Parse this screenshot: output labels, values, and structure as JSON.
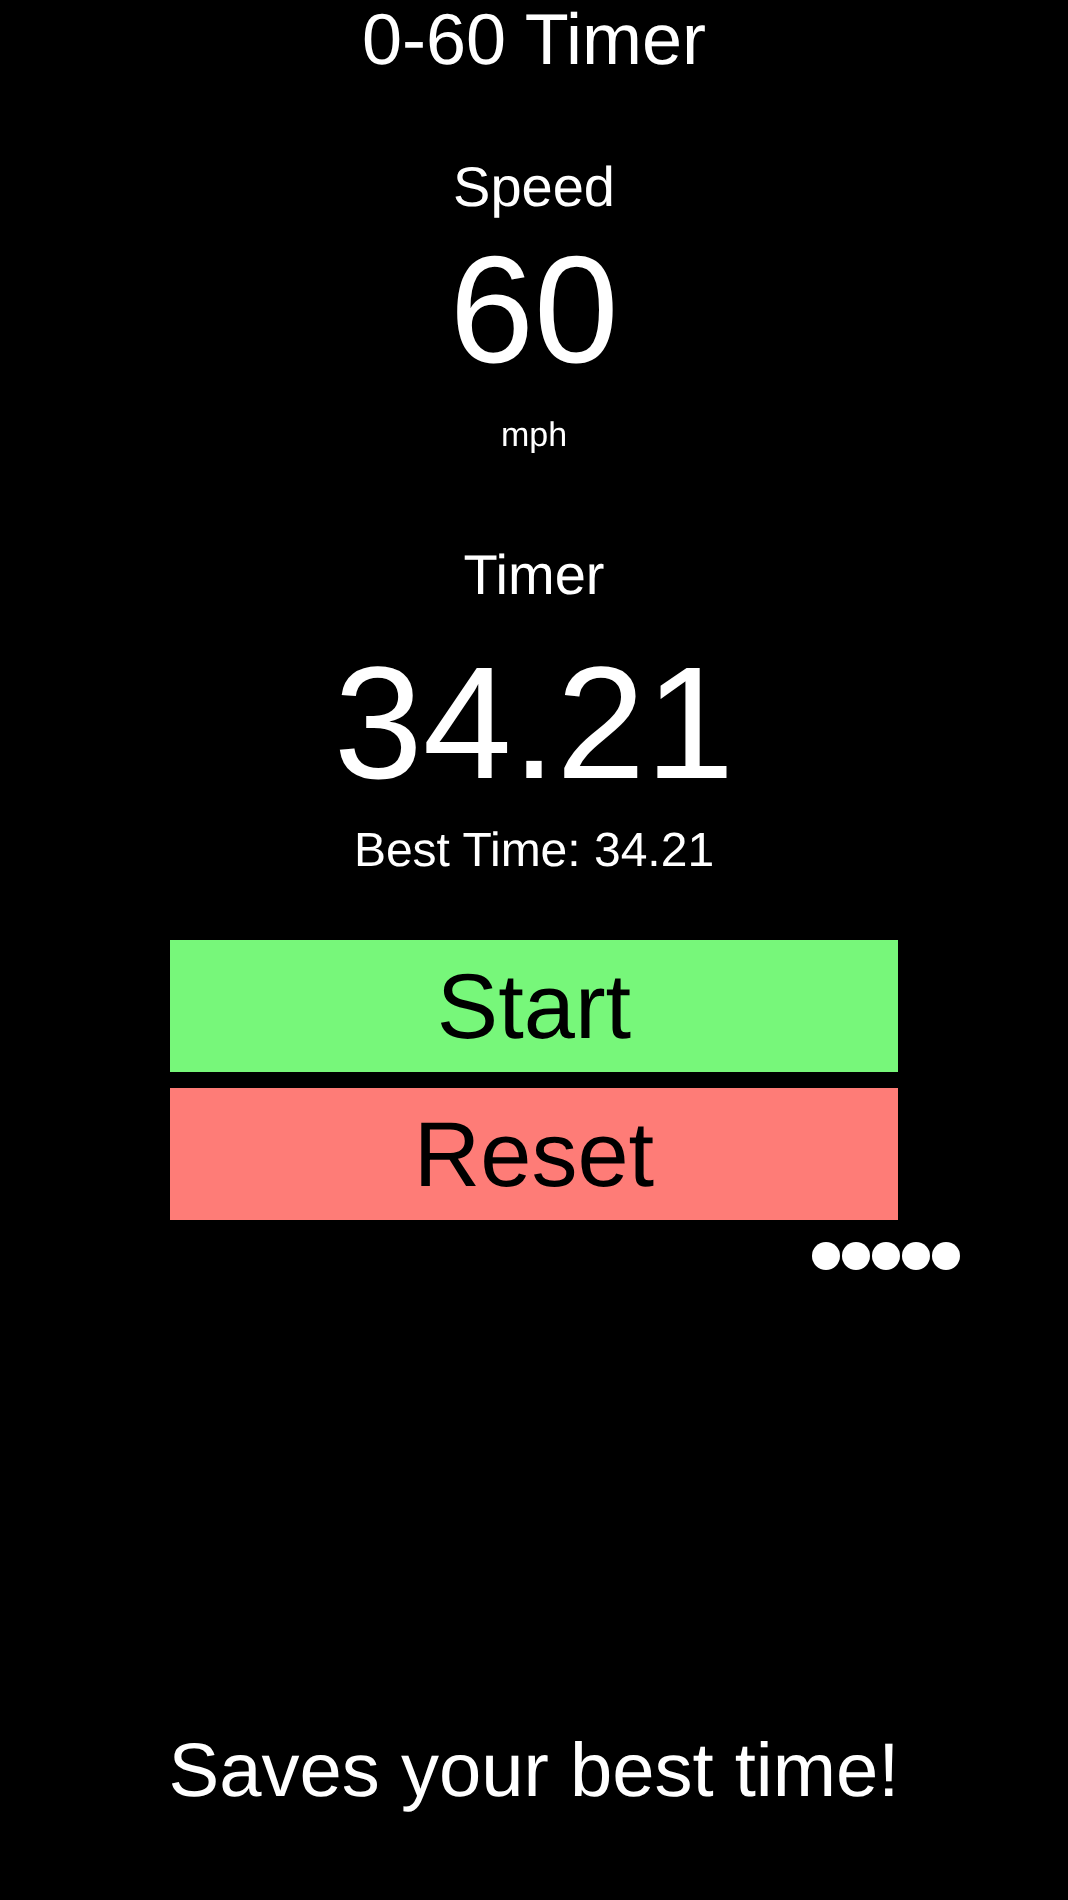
{
  "title": "0-60 Timer",
  "speed": {
    "label": "Speed",
    "value": "60",
    "unit": "mph"
  },
  "timer": {
    "label": "Timer",
    "value": "34.21",
    "best": "Best Time: 34.21"
  },
  "buttons": [
    {
      "label": "Start",
      "kind": "start"
    },
    {
      "label": "Reset",
      "kind": "reset"
    }
  ],
  "caption": "Saves your best time!"
}
